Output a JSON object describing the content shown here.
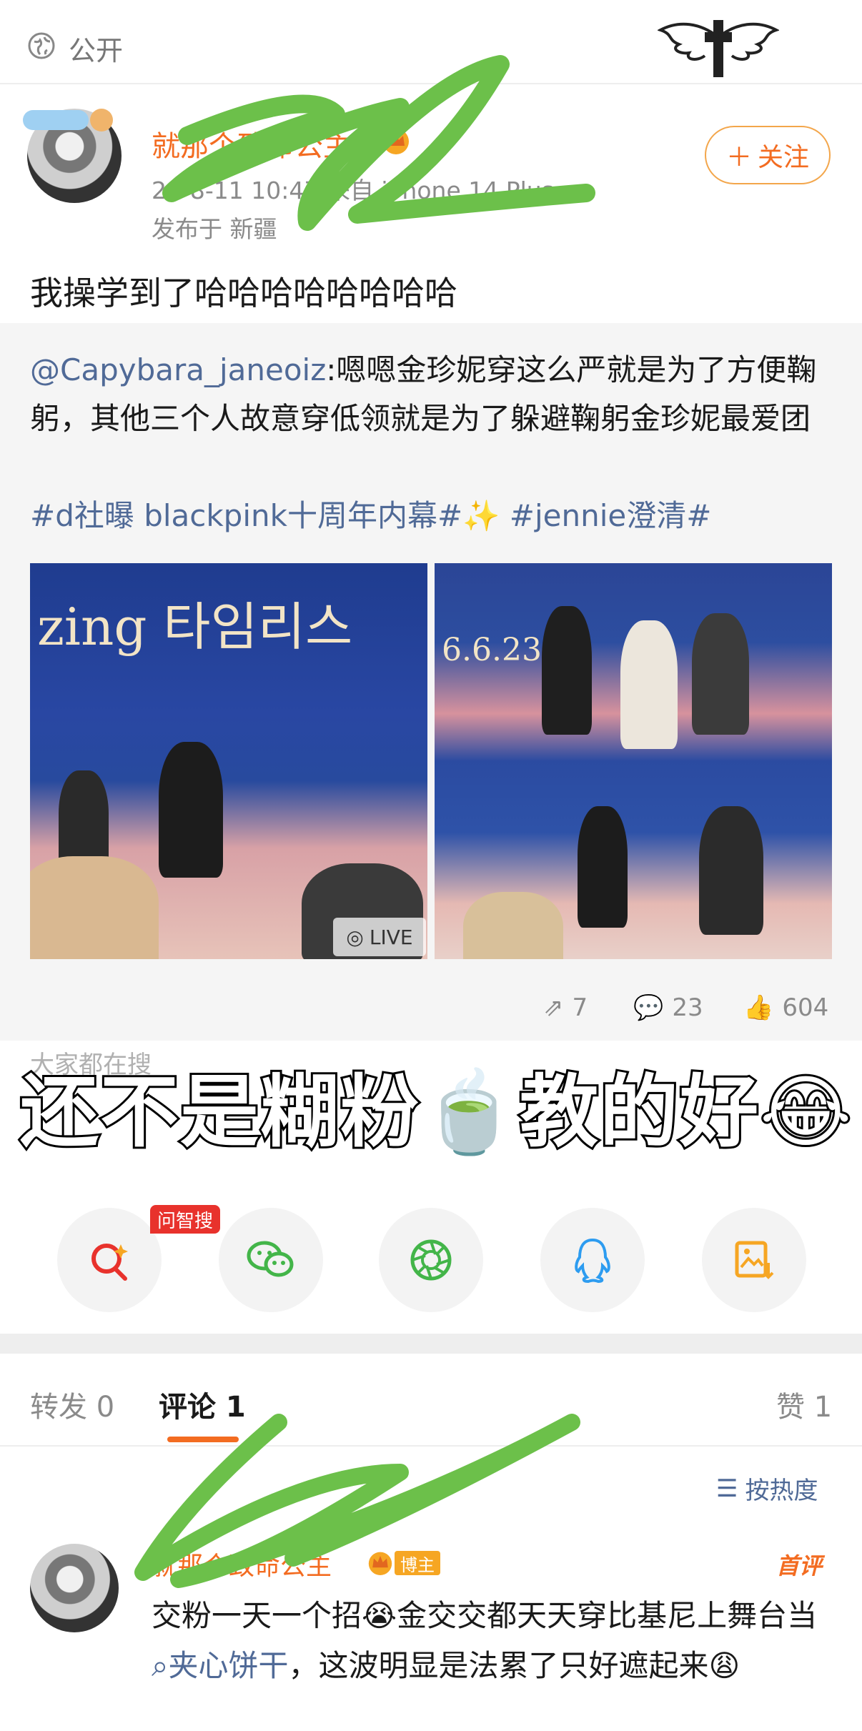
{
  "topbar": {
    "visibility_label": "公开",
    "icon": "globe-icon"
  },
  "post": {
    "author": "就那个致命公主",
    "timestamp_source": "26-8-11 10:47  来自 iPhone 14 Plus",
    "location": "发布于 新疆",
    "follow_label": "关注",
    "text": "我操学到了哈哈哈哈哈哈哈哈"
  },
  "repost": {
    "mention": "@Capybara_janeoiz",
    "text": ":嗯嗯金珍妮穿这么严就是为了方便鞠躬，其他三个人故意穿低领就是为了躲避鞠躬金珍妮最爱团",
    "hashtags": "#d社曝 blackpink十周年内幕#✨ #jennie澄清#",
    "photo_left_banner": "zing 타임리스",
    "photo_right_banner": "6.6.23",
    "live_label": "LIVE",
    "stats": {
      "reposts": "7",
      "comments": "23",
      "likes": "604"
    }
  },
  "overlay": {
    "searching_label": "大家都在搜",
    "caption": "还不是糊粉🍵教的好😂"
  },
  "share": {
    "ask_badge": "问智搜"
  },
  "tabs": {
    "repost": "转发 0",
    "comments": "评论 1",
    "likes": "赞 1"
  },
  "sort_label": "按热度",
  "comment": {
    "author": "就那个致命公主",
    "tag": "博主",
    "first_label": "首评",
    "text_a": "交粉一天一个招😭金交交都天天穿比基尼上舞台当",
    "link": "夹心饼干",
    "text_b": "，这波明显是法累了只好遮起来😩"
  },
  "colors": {
    "accent": "#f36c21",
    "link": "#506a97",
    "scribble": "#6cc04a"
  }
}
